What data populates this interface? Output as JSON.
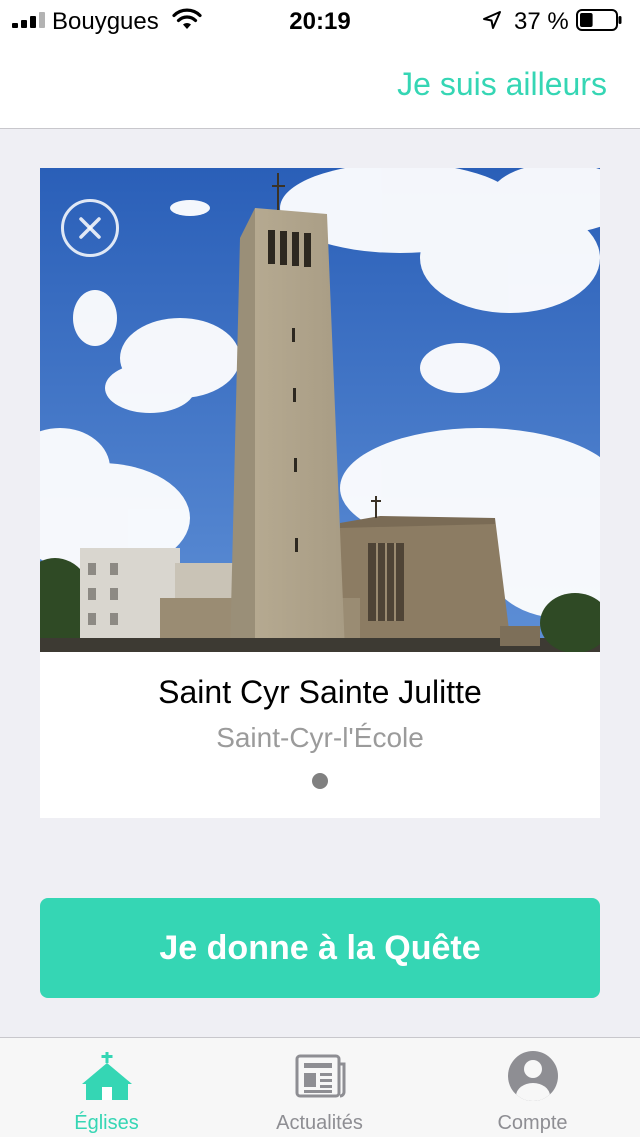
{
  "status_bar": {
    "carrier": "Bouygues",
    "time": "20:19",
    "battery_percent": "37 %",
    "battery_level": 0.37
  },
  "nav": {
    "elsewhere_link": "Je suis ailleurs"
  },
  "church_card": {
    "name": "Saint Cyr Sainte Julitte",
    "city": "Saint-Cyr-l'École",
    "page_index": 1,
    "page_count": 1
  },
  "give_button": {
    "label": "Je donne à la Quête"
  },
  "tab_bar": {
    "tabs": [
      {
        "label": "Églises",
        "icon": "church-icon",
        "active": true
      },
      {
        "label": "Actualités",
        "icon": "newspaper-icon",
        "active": false
      },
      {
        "label": "Compte",
        "icon": "account-icon",
        "active": false
      }
    ]
  },
  "colors": {
    "accent": "#35d6b4",
    "background": "#efeff4",
    "inactive": "#8e8e93"
  }
}
